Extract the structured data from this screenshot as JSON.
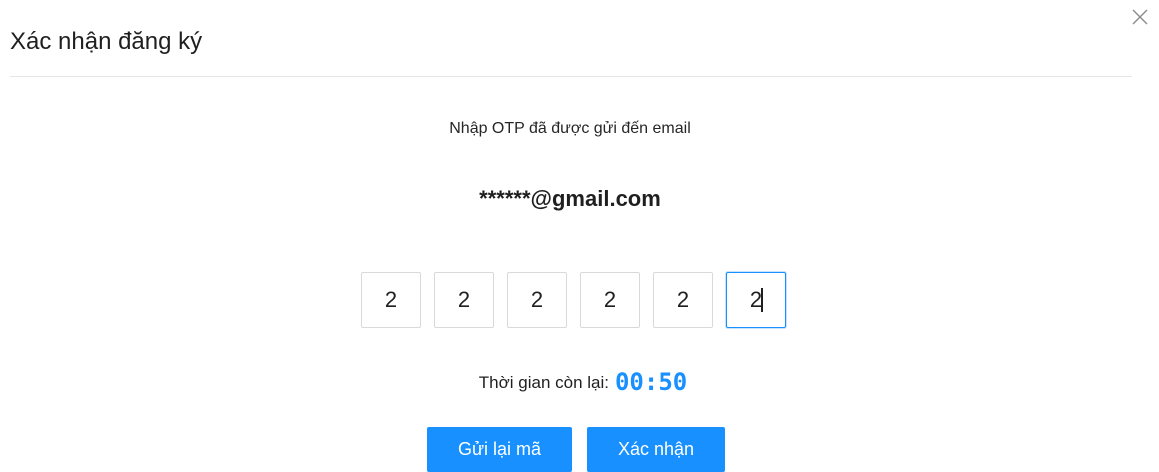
{
  "modal": {
    "title": "Xác nhận đăng ký",
    "close_icon": "close-icon"
  },
  "content": {
    "instruction": "Nhập OTP đã được gửi đến email",
    "email": "******@gmail.com",
    "otp_digits": [
      "2",
      "2",
      "2",
      "2",
      "2",
      "2"
    ],
    "active_otp_index": 5,
    "timer_label": "Thời gian còn lại:",
    "timer_value": "00:50"
  },
  "actions": {
    "resend_label": "Gửi lại mã",
    "confirm_label": "Xác nhận"
  },
  "colors": {
    "primary": "#1890ff",
    "divider": "#e6e6e6",
    "input_border": "#d9d9d9"
  }
}
